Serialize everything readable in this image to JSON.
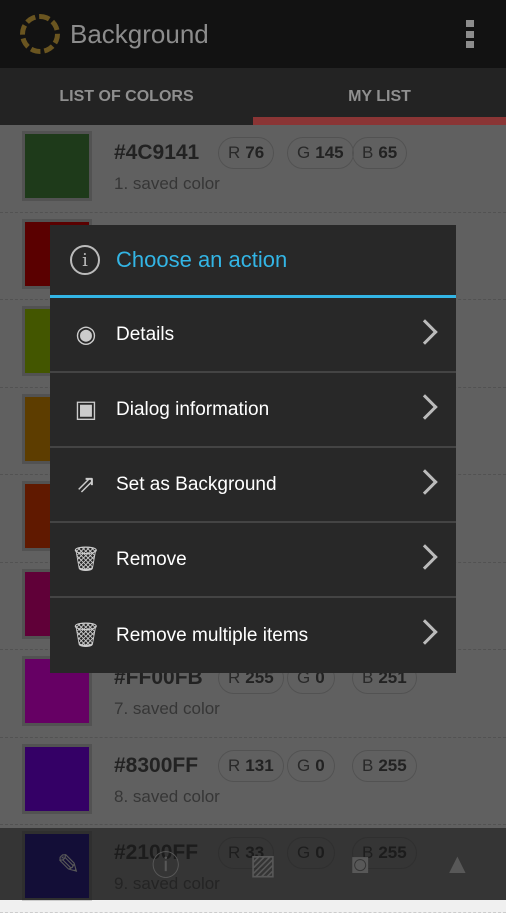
{
  "app": {
    "title": "Background",
    "icon": "color-picker-logo",
    "menu_icon": "overflow-menu-icon"
  },
  "tabs": [
    {
      "label": "LIST OF COLORS",
      "active": false
    },
    {
      "label": "MY LIST",
      "active": true
    }
  ],
  "accent": "#e05555",
  "colors": [
    {
      "swatch": "#4C9141",
      "hex": "#4C9141",
      "r": "76",
      "g": "145",
      "b": "65",
      "label": "1. saved color"
    },
    {
      "swatch": "#E00000"
    },
    {
      "swatch": "#A8D800"
    },
    {
      "swatch": "#E89A00"
    },
    {
      "swatch": "#F04000"
    },
    {
      "swatch": "#F0008C"
    },
    {
      "swatch": "#FF00FB",
      "hex": "#FF00FB",
      "r": "255",
      "g": "0",
      "b": "251",
      "label": "7. saved color"
    },
    {
      "swatch": "#8300FF",
      "hex": "#8300FF",
      "r": "131",
      "g": "0",
      "b": "255",
      "label": "8. saved color"
    },
    {
      "swatch": "#2100FF",
      "hex": "#2100FF",
      "r": "33",
      "g": "0",
      "b": "255",
      "label": "9. saved color"
    }
  ],
  "bottom_bar": [
    "eyedropper-icon",
    "info-icon",
    "image-icon",
    "camera-icon",
    "navigate-icon"
  ],
  "dialog": {
    "title": "Choose an action",
    "title_color": "#33b5e5",
    "items": [
      {
        "label": "Details",
        "icon": "eye-icon"
      },
      {
        "label": "Dialog information",
        "icon": "document-icon"
      },
      {
        "label": "Set as Background",
        "icon": "share-icon"
      },
      {
        "label": "Remove",
        "icon": "trash-icon"
      },
      {
        "label": "Remove multiple items",
        "icon": "trash-icon"
      }
    ]
  }
}
